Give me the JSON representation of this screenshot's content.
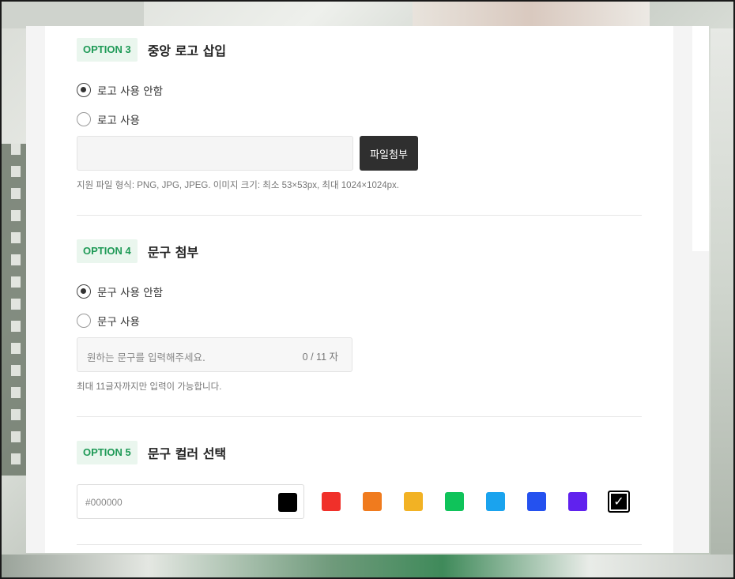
{
  "options": [
    {
      "badge": "OPTION 3",
      "title": "중앙 로고 삽입",
      "radios": [
        {
          "label": "로고 사용 안함",
          "checked": true
        },
        {
          "label": "로고 사용",
          "checked": false
        }
      ],
      "attach_label": "파일첨부",
      "help": "지원 파일 형식: PNG, JPG, JPEG. 이미지 크기: 최소 53×53px, 최대 1024×1024px."
    },
    {
      "badge": "OPTION 4",
      "title": "문구 첨부",
      "radios": [
        {
          "label": "문구 사용 안함",
          "checked": true
        },
        {
          "label": "문구 사용",
          "checked": false
        }
      ],
      "input_placeholder": "원하는 문구를 입력해주세요.",
      "counter": "0 / 11 자",
      "help": "최대 11글자까지만 입력이 가능합니다."
    },
    {
      "badge": "OPTION 5",
      "title": "문구 컬러 선택",
      "hex_value": "#000000",
      "swatches": [
        {
          "name": "red",
          "color": "#f0302a"
        },
        {
          "name": "orange",
          "color": "#f07b1e"
        },
        {
          "name": "yellow",
          "color": "#f2b224"
        },
        {
          "name": "green",
          "color": "#0fc35a"
        },
        {
          "name": "sky-blue",
          "color": "#1aa3ee"
        },
        {
          "name": "blue",
          "color": "#2451ef"
        },
        {
          "name": "purple",
          "color": "#6022ee"
        },
        {
          "name": "black",
          "color": "#000000",
          "selected": true
        }
      ]
    }
  ]
}
